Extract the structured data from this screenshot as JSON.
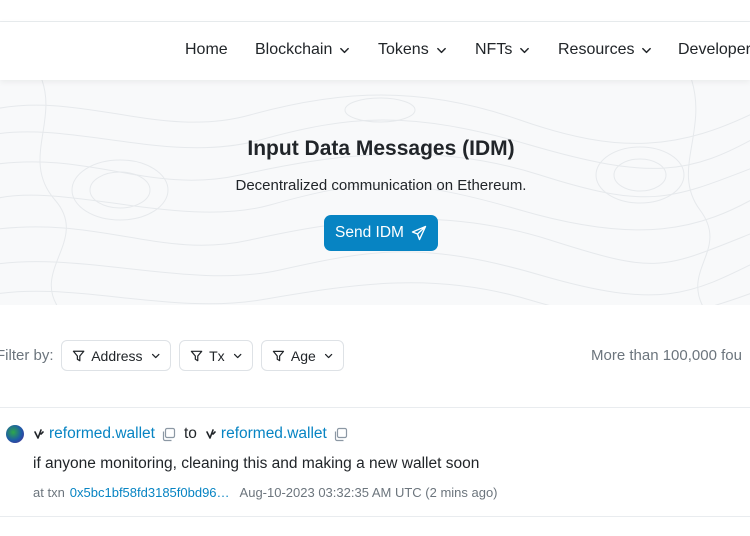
{
  "nav": {
    "items": [
      {
        "label": "Home",
        "dropdown": false
      },
      {
        "label": "Blockchain",
        "dropdown": true
      },
      {
        "label": "Tokens",
        "dropdown": true
      },
      {
        "label": "NFTs",
        "dropdown": true
      },
      {
        "label": "Resources",
        "dropdown": true
      },
      {
        "label": "Developer",
        "dropdown": false
      }
    ]
  },
  "hero": {
    "title": "Input Data Messages (IDM)",
    "subtitle": "Decentralized communication on Ethereum.",
    "button_label": "Send IDM",
    "button_icon": "paper-plane-icon"
  },
  "filter": {
    "label": "Filter by:",
    "buttons": [
      {
        "label": "Address",
        "icon": "filter-icon"
      },
      {
        "label": "Tx",
        "icon": "filter-icon"
      },
      {
        "label": "Age",
        "icon": "filter-icon"
      }
    ],
    "result_count": "More than 100,000 fou"
  },
  "messages": [
    {
      "from": "reformed.wallet",
      "to_word": "to",
      "to": "reformed.wallet",
      "text": "if anyone monitoring, cleaning this and making a new wallet soon",
      "at_txn_label": "at txn",
      "txn_hash": "0x5bc1bf58fd3185f0bd96…",
      "timestamp": "Aug-10-2023 03:32:35 AM UTC (2 mins ago)"
    }
  ],
  "colors": {
    "accent": "#0784c3",
    "text": "#212529",
    "muted": "#6c757d",
    "hero_bg": "#f8f9fa"
  }
}
